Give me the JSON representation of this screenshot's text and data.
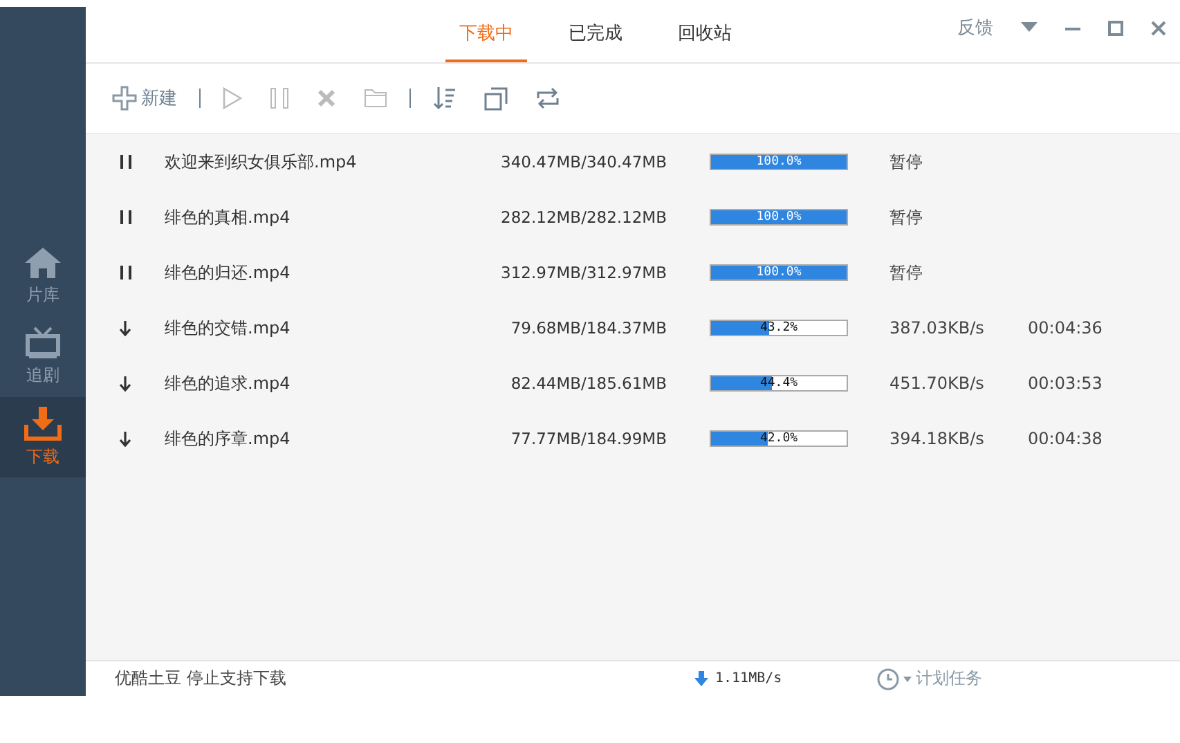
{
  "sidebar": {
    "items": [
      {
        "label": "片库",
        "selected": false
      },
      {
        "label": "追剧",
        "selected": false
      },
      {
        "label": "下载",
        "selected": true
      }
    ]
  },
  "tabs": [
    {
      "label": "下载中",
      "selected": true
    },
    {
      "label": "已完成",
      "selected": false
    },
    {
      "label": "回收站",
      "selected": false
    }
  ],
  "header": {
    "feedback": "反馈"
  },
  "toolbar": {
    "new_label": "新建"
  },
  "downloads": [
    {
      "kind": "paused",
      "name": "欢迎来到织女俱乐部.mp4",
      "size": "340.47MB/340.47MB",
      "level": 1,
      "percent": "100.0%",
      "status": "暂停"
    },
    {
      "kind": "paused",
      "name": "绯色的真相.mp4",
      "size": "282.12MB/282.12MB",
      "level": 1,
      "percent": "100.0%",
      "status": "暂停"
    },
    {
      "kind": "paused",
      "name": "绯色的归还.mp4",
      "size": "312.97MB/312.97MB",
      "level": 1,
      "percent": "100.0%",
      "status": "暂停"
    },
    {
      "kind": "downloading",
      "name": "绯色的交错.mp4",
      "size": "79.68MB/184.37MB",
      "level": 0.432,
      "percent": "43.2%",
      "status": "387.03KB/s",
      "remaining": "00:04:36"
    },
    {
      "kind": "downloading",
      "name": "绯色的追求.mp4",
      "size": "82.44MB/185.61MB",
      "level": 0.444,
      "percent": "44.4%",
      "status": "451.70KB/s",
      "remaining": "00:03:53"
    },
    {
      "kind": "downloading",
      "name": "绯色的序章.mp4",
      "size": "77.77MB/184.99MB",
      "level": 0.42,
      "percent": "42.0%",
      "status": "394.18KB/s",
      "remaining": "00:04:38"
    }
  ],
  "status_bar": {
    "notice": "优酷土豆 停止支持下载",
    "total_speed": "1.11MB/s",
    "schedule": "计划任务"
  }
}
